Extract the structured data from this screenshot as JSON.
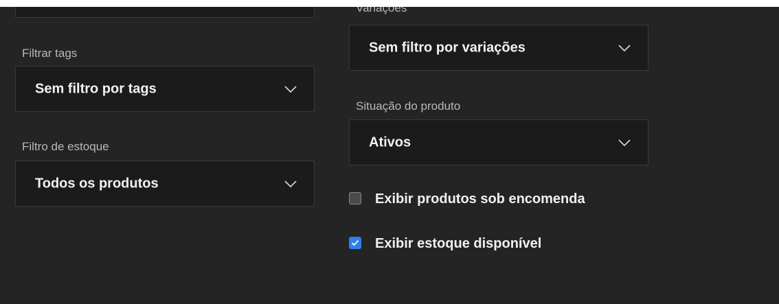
{
  "left_column": {
    "top_select_value": "",
    "tags": {
      "label": "Filtrar tags",
      "value": "Sem filtro por tags",
      "icon": "chevron-down-icon"
    },
    "estoque": {
      "label": "Filtro de estoque",
      "value": "Todos os produtos",
      "icon": "chevron-down-icon"
    }
  },
  "right_column": {
    "variacoes": {
      "label": "Variações",
      "value": "Sem filtro por variações",
      "icon": "chevron-down-icon"
    },
    "situacao": {
      "label": "Situação do produto",
      "value": "Ativos",
      "icon": "chevron-down-icon"
    },
    "checkboxes": [
      {
        "label": "Exibir produtos sob encomenda",
        "checked": false
      },
      {
        "label": "Exibir estoque disponível",
        "checked": true
      }
    ]
  },
  "colors": {
    "background": "#242424",
    "select_bg": "#1b1b1b",
    "select_border": "#3a3a3a",
    "accent": "#2f7fe8",
    "label_text": "#b9b9b9",
    "value_text": "#f2f2f2"
  }
}
